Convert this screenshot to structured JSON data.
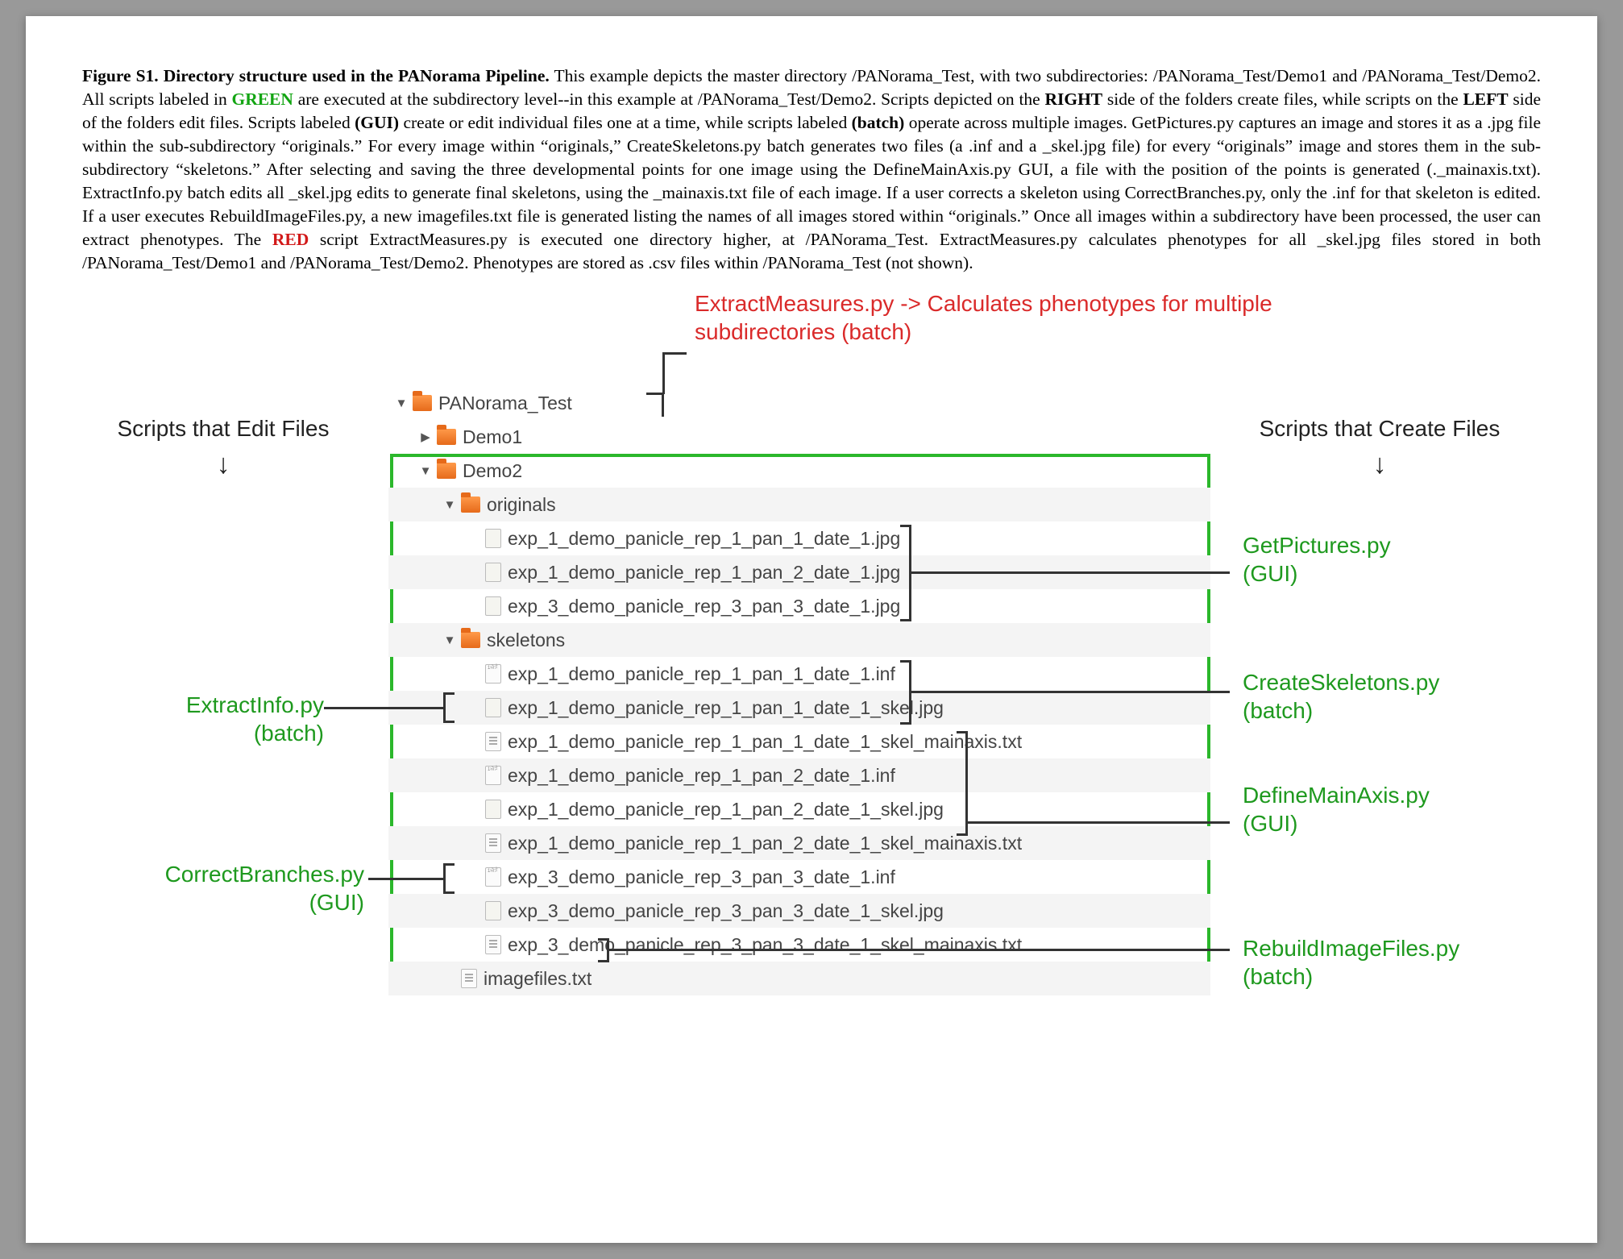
{
  "caption": {
    "figLabel": "Figure S1.  Directory structure used in the PANorama Pipeline.",
    "sent1a": " This example depicts the master directory /PANorama_Test, with two subdirectories: /PANorama_Test/Demo1 and /PANorama_Test/Demo2.  All scripts labeled in ",
    "green": "GREEN",
    "sent1b": " are executed at the subdirectory level--in this example at /PANorama_Test/Demo2.  Scripts depicted on the ",
    "right": "RIGHT",
    "sent1c": " side of the folders create files, while scripts on the ",
    "left": "LEFT",
    "sent1d": " side of the folders edit files.  Scripts labeled ",
    "gui": "(GUI)",
    "sent1e": " create or edit individual files one at a time, while scripts labeled ",
    "batch": "(batch)",
    "sent1f": " operate across multiple images.   GetPictures.py captures an image and stores it as a .jpg file within the sub-subdirectory “originals.”  For every image within “originals,” CreateSkeletons.py batch generates two files (a .inf and a _skel.jpg file) for every “originals” image and stores them in the sub-subdirectory “skeletons.”  After selecting and saving the three developmental points for one image using the DefineMainAxis.py GUI, a file with the position of the points is generated (._mainaxis.txt).  ExtractInfo.py batch edits all _skel.jpg edits to generate final skeletons, using the _mainaxis.txt file of each image.  If a user corrects a skeleton using CorrectBranches.py, only the .inf for that skeleton is edited.  If a user executes RebuildImageFiles.py, a new imagefiles.txt file is generated listing the names of all images stored within “originals.”  Once all images within a subdirectory have been processed, the user can extract phenotypes.  The ",
    "red": "RED",
    "sent1g": " script ExtractMeasures.py is executed one directory higher, at /PANorama_Test.  ExtractMeasures.py calculates phenotypes for all _skel.jpg files stored in both /PANorama_Test/Demo1 and /PANorama_Test/Demo2.  Phenotypes are stored as .csv files within /PANorama_Test (not shown)."
  },
  "annotations": {
    "extractMeasures": "ExtractMeasures.py -> Calculates phenotypes for multiple subdirectories (batch)",
    "scriptsEdit": "Scripts that Edit Files",
    "scriptsCreate": "Scripts that Create Files",
    "getPictures1": "GetPictures.py",
    "getPictures2": "(GUI)",
    "createSkeletons1": "CreateSkeletons.py",
    "createSkeletons2": "(batch)",
    "defineMainAxis1": "DefineMainAxis.py",
    "defineMainAxis2": "(GUI)",
    "rebuild1": "RebuildImageFiles.py",
    "rebuild2": "(batch)",
    "extractInfo1": "ExtractInfo.py",
    "extractInfo2": "(batch)",
    "correctBranches1": "CorrectBranches.py",
    "correctBranches2": "(GUI)"
  },
  "tree": {
    "root": "PANorama_Test",
    "demo1": "Demo1",
    "demo2": "Demo2",
    "originals": "originals",
    "orig_files": [
      "exp_1_demo_panicle_rep_1_pan_1_date_1.jpg",
      "exp_1_demo_panicle_rep_1_pan_2_date_1.jpg",
      "exp_3_demo_panicle_rep_3_pan_3_date_1.jpg"
    ],
    "skeletons": "skeletons",
    "skel_files": [
      "exp_1_demo_panicle_rep_1_pan_1_date_1.inf",
      "exp_1_demo_panicle_rep_1_pan_1_date_1_skel.jpg",
      "exp_1_demo_panicle_rep_1_pan_1_date_1_skel_mainaxis.txt",
      "exp_1_demo_panicle_rep_1_pan_2_date_1.inf",
      "exp_1_demo_panicle_rep_1_pan_2_date_1_skel.jpg",
      "exp_1_demo_panicle_rep_1_pan_2_date_1_skel_mainaxis.txt",
      "exp_3_demo_panicle_rep_3_pan_3_date_1.inf",
      "exp_3_demo_panicle_rep_3_pan_3_date_1_skel.jpg",
      "exp_3_demo_panicle_rep_3_pan_3_date_1_skel_mainaxis.txt"
    ],
    "imagefiles": "imagefiles.txt"
  }
}
